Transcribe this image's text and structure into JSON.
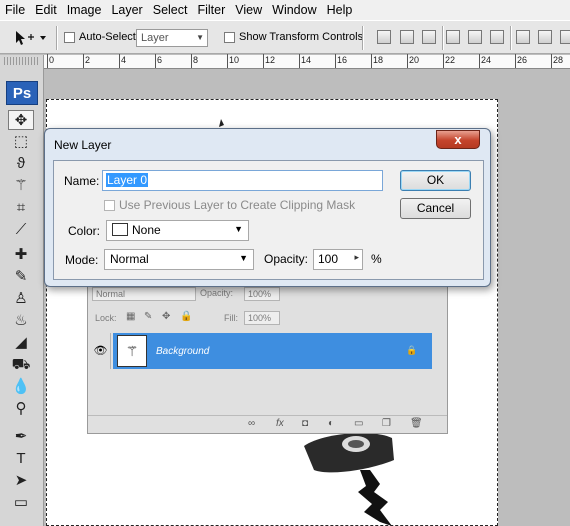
{
  "menu": [
    "File",
    "Edit",
    "Image",
    "Layer",
    "Select",
    "Filter",
    "View",
    "Window",
    "Help"
  ],
  "options": {
    "tool_icon": "move-tool-icon",
    "auto_select_label": "Auto-Select:",
    "auto_select_value": "Layer",
    "show_transform_label": "Show Transform Controls"
  },
  "ruler": [
    "0",
    "2",
    "4",
    "6",
    "8",
    "10",
    "12",
    "14",
    "16",
    "18",
    "20",
    "22",
    "24",
    "26",
    "28"
  ],
  "toolbox": {
    "logo": "Ps"
  },
  "dialog": {
    "title": "New Layer",
    "close": "x",
    "name_label": "Name:",
    "name_value": "Layer 0",
    "clip_label": "Use Previous Layer to Create Clipping Mask",
    "color_label": "Color:",
    "color_value": "None",
    "mode_label": "Mode:",
    "mode_value": "Normal",
    "opacity_label": "Opacity:",
    "opacity_value": "100",
    "opacity_unit": "%",
    "ok_label": "OK",
    "cancel_label": "Cancel"
  },
  "layers": {
    "blend_mode": "Normal",
    "opacity_label": "Opacity:",
    "opacity_value": "100%",
    "lock_label": "Lock:",
    "fill_label": "Fill:",
    "fill_value": "100%",
    "layer_name": "Background"
  }
}
